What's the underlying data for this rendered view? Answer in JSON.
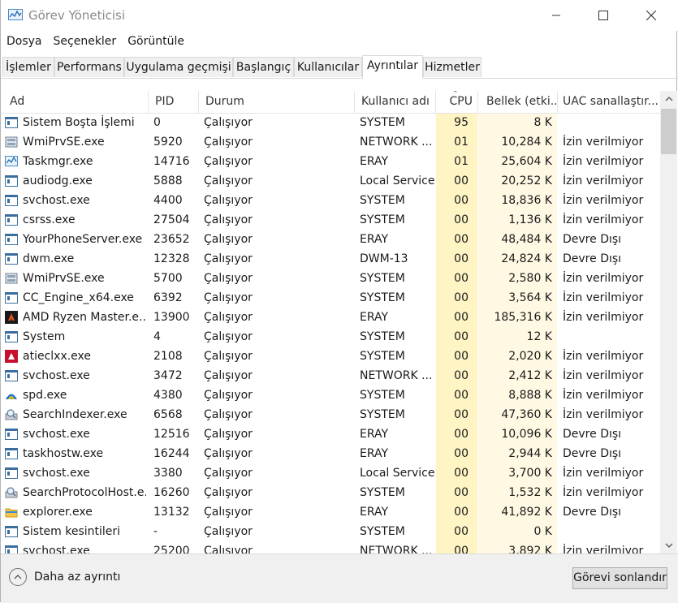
{
  "window": {
    "title": "Görev Yöneticisi"
  },
  "menu": [
    "Dosya",
    "Seçenekler",
    "Görüntüle"
  ],
  "tabs": [
    "İşlemler",
    "Performans",
    "Uygulama geçmişi",
    "Başlangıç",
    "Kullanıcılar",
    "Ayrıntılar",
    "Hizmetler"
  ],
  "active_tab": "Ayrıntılar",
  "columns": [
    "Ad",
    "PID",
    "Durum",
    "Kullanıcı adı",
    "CPU",
    "Bellek (etki...",
    "UAC sanallaştır..."
  ],
  "rows": [
    {
      "name": "Sistem Boşta İşlemi",
      "pid": "0",
      "status": "Çalışıyor",
      "user": "SYSTEM",
      "cpu": "95",
      "mem": "8 K",
      "uac": "",
      "icon": "system-window-icon"
    },
    {
      "name": "WmiPrvSE.exe",
      "pid": "5920",
      "status": "Çalışıyor",
      "user": "NETWORK ...",
      "cpu": "01",
      "mem": "10,284 K",
      "uac": "İzin verilmiyor",
      "icon": "wmi-icon"
    },
    {
      "name": "Taskmgr.exe",
      "pid": "14716",
      "status": "Çalışıyor",
      "user": "ERAY",
      "cpu": "01",
      "mem": "25,604 K",
      "uac": "İzin verilmiyor",
      "icon": "taskmgr-icon"
    },
    {
      "name": "audiodg.exe",
      "pid": "5888",
      "status": "Çalışıyor",
      "user": "Local Service",
      "cpu": "00",
      "mem": "20,252 K",
      "uac": "İzin verilmiyor",
      "icon": "window-icon"
    },
    {
      "name": "svchost.exe",
      "pid": "4400",
      "status": "Çalışıyor",
      "user": "SYSTEM",
      "cpu": "00",
      "mem": "18,836 K",
      "uac": "İzin verilmiyor",
      "icon": "window-icon"
    },
    {
      "name": "csrss.exe",
      "pid": "27504",
      "status": "Çalışıyor",
      "user": "SYSTEM",
      "cpu": "00",
      "mem": "1,136 K",
      "uac": "İzin verilmiyor",
      "icon": "window-icon"
    },
    {
      "name": "YourPhoneServer.exe",
      "pid": "23652",
      "status": "Çalışıyor",
      "user": "ERAY",
      "cpu": "00",
      "mem": "48,484 K",
      "uac": "Devre Dışı",
      "icon": "window-icon"
    },
    {
      "name": "dwm.exe",
      "pid": "12328",
      "status": "Çalışıyor",
      "user": "DWM-13",
      "cpu": "00",
      "mem": "24,824 K",
      "uac": "Devre Dışı",
      "icon": "window-icon"
    },
    {
      "name": "WmiPrvSE.exe",
      "pid": "5700",
      "status": "Çalışıyor",
      "user": "SYSTEM",
      "cpu": "00",
      "mem": "2,580 K",
      "uac": "İzin verilmiyor",
      "icon": "wmi-icon"
    },
    {
      "name": "CC_Engine_x64.exe",
      "pid": "6392",
      "status": "Çalışıyor",
      "user": "SYSTEM",
      "cpu": "00",
      "mem": "3,564 K",
      "uac": "İzin verilmiyor",
      "icon": "window-icon"
    },
    {
      "name": "AMD Ryzen Master.e...",
      "pid": "13900",
      "status": "Çalışıyor",
      "user": "ERAY",
      "cpu": "00",
      "mem": "185,316 K",
      "uac": "İzin verilmiyor",
      "icon": "ryzen-icon"
    },
    {
      "name": "System",
      "pid": "4",
      "status": "Çalışıyor",
      "user": "SYSTEM",
      "cpu": "00",
      "mem": "12 K",
      "uac": "",
      "icon": "window-icon"
    },
    {
      "name": "atieclxx.exe",
      "pid": "2108",
      "status": "Çalışıyor",
      "user": "SYSTEM",
      "cpu": "00",
      "mem": "2,020 K",
      "uac": "İzin verilmiyor",
      "icon": "amd-icon"
    },
    {
      "name": "svchost.exe",
      "pid": "3472",
      "status": "Çalışıyor",
      "user": "NETWORK ...",
      "cpu": "00",
      "mem": "2,412 K",
      "uac": "İzin verilmiyor",
      "icon": "window-icon"
    },
    {
      "name": "spd.exe",
      "pid": "4380",
      "status": "Çalışıyor",
      "user": "SYSTEM",
      "cpu": "00",
      "mem": "8,888 K",
      "uac": "İzin verilmiyor",
      "icon": "spd-icon"
    },
    {
      "name": "SearchIndexer.exe",
      "pid": "6568",
      "status": "Çalışıyor",
      "user": "SYSTEM",
      "cpu": "00",
      "mem": "47,360 K",
      "uac": "İzin verilmiyor",
      "icon": "search-indexer-icon"
    },
    {
      "name": "svchost.exe",
      "pid": "12516",
      "status": "Çalışıyor",
      "user": "ERAY",
      "cpu": "00",
      "mem": "10,096 K",
      "uac": "Devre Dışı",
      "icon": "window-icon"
    },
    {
      "name": "taskhostw.exe",
      "pid": "16244",
      "status": "Çalışıyor",
      "user": "ERAY",
      "cpu": "00",
      "mem": "2,944 K",
      "uac": "Devre Dışı",
      "icon": "window-icon"
    },
    {
      "name": "svchost.exe",
      "pid": "3380",
      "status": "Çalışıyor",
      "user": "Local Service",
      "cpu": "00",
      "mem": "3,700 K",
      "uac": "İzin verilmiyor",
      "icon": "window-icon"
    },
    {
      "name": "SearchProtocolHost.e...",
      "pid": "16260",
      "status": "Çalışıyor",
      "user": "SYSTEM",
      "cpu": "00",
      "mem": "1,532 K",
      "uac": "İzin verilmiyor",
      "icon": "search-indexer-icon"
    },
    {
      "name": "explorer.exe",
      "pid": "13132",
      "status": "Çalışıyor",
      "user": "ERAY",
      "cpu": "00",
      "mem": "41,892 K",
      "uac": "Devre Dışı",
      "icon": "explorer-icon"
    },
    {
      "name": "Sistem kesintileri",
      "pid": "-",
      "status": "Çalışıyor",
      "user": "SYSTEM",
      "cpu": "00",
      "mem": "0 K",
      "uac": "",
      "icon": "system-window-icon"
    },
    {
      "name": "svchost.exe",
      "pid": "25200",
      "status": "Çalışıyor",
      "user": "NETWORK ...",
      "cpu": "00",
      "mem": "3,892 K",
      "uac": "İzin verilmiyor",
      "icon": "window-icon"
    }
  ],
  "footer": {
    "fewer_details": "Daha az ayrıntı",
    "end_task": "Görevi sonlandır"
  },
  "colors": {
    "cpu_column_bg": "#fff4c4",
    "mem_column_bg": "#fff9e4",
    "accent": "#0078d7"
  }
}
